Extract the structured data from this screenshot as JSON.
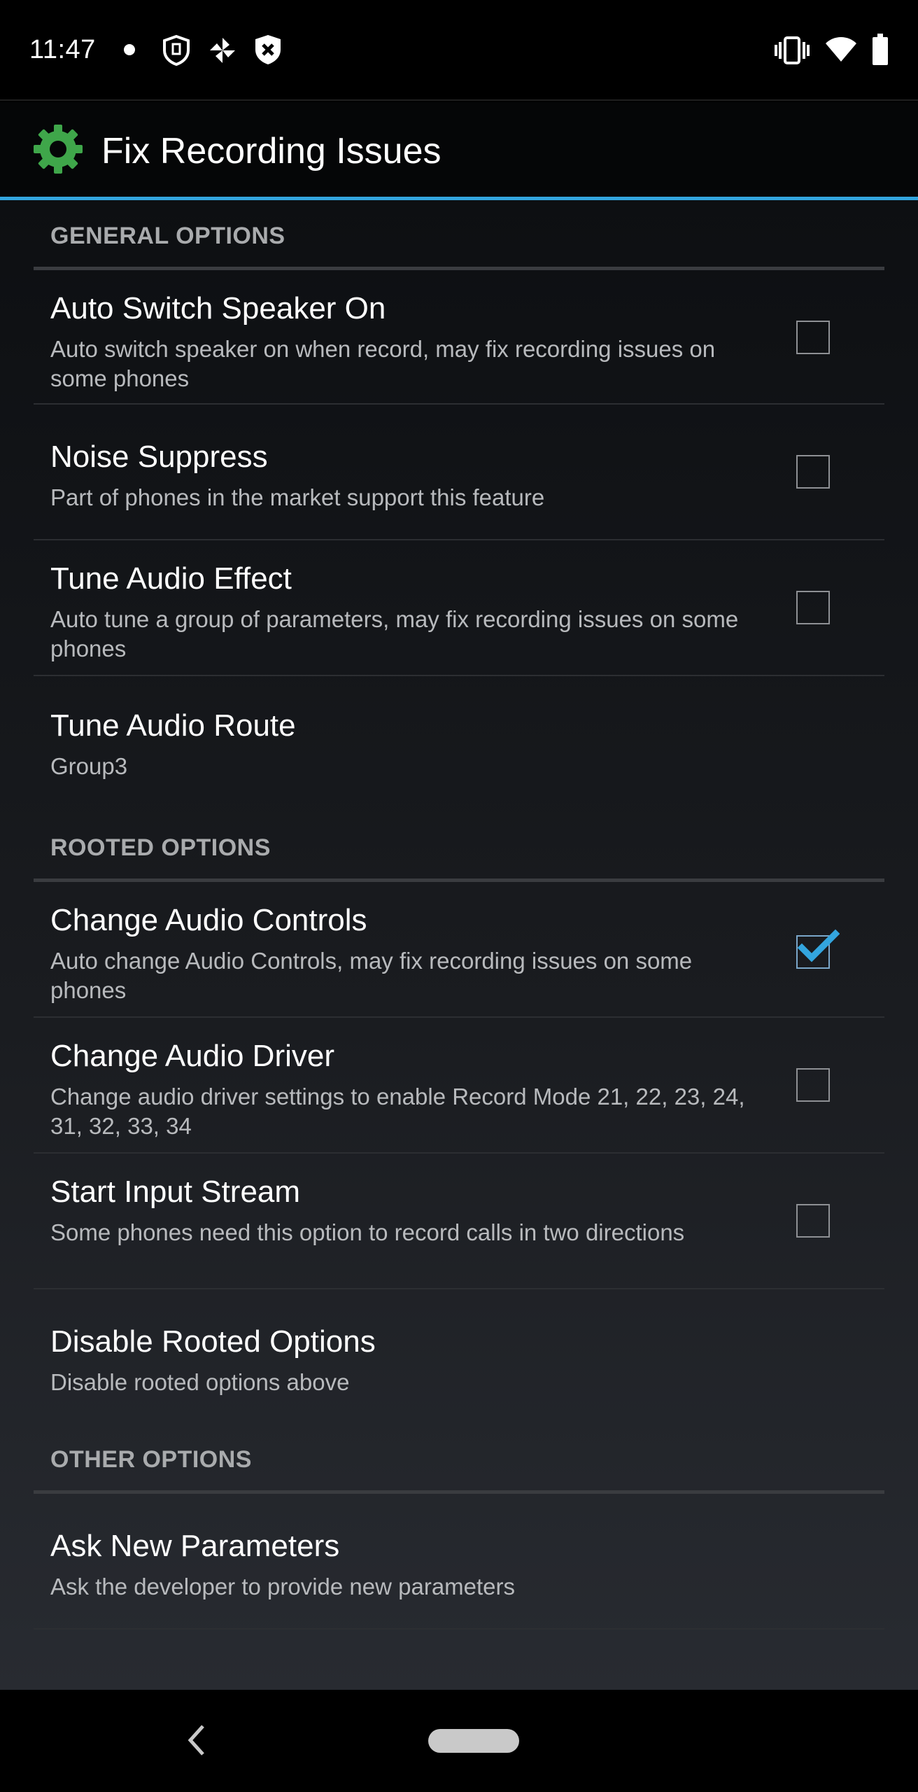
{
  "status_bar": {
    "time": "11:47",
    "left_icons": [
      "dot-icon",
      "shield-icon",
      "pinwheel-icon",
      "shield-x-icon"
    ],
    "right_icons": [
      "vibrate-icon",
      "wifi-icon",
      "battery-icon"
    ]
  },
  "action_bar": {
    "title": "Fix Recording Issues",
    "icon": "gear-icon",
    "icon_color": "#3fa64a"
  },
  "colors": {
    "accent": "#33a5de",
    "background": "#000000"
  },
  "sections": {
    "general": {
      "header": "GENERAL OPTIONS",
      "items": [
        {
          "title": "Auto Switch Speaker On",
          "summary": "Auto switch speaker on when record, may fix recording issues on some phones",
          "checked": false
        },
        {
          "title": "Noise Suppress",
          "summary": "Part of phones in the market support this feature",
          "checked": false
        },
        {
          "title": "Tune Audio Effect",
          "summary": "Auto tune a group of parameters, may fix recording issues on some phones",
          "checked": false
        },
        {
          "title": "Tune Audio Route",
          "summary": "Group3"
        }
      ]
    },
    "rooted": {
      "header": "ROOTED OPTIONS",
      "items": [
        {
          "title": "Change Audio Controls",
          "summary": "Auto change Audio Controls, may fix recording issues on some phones",
          "checked": true
        },
        {
          "title": "Change Audio Driver",
          "summary": "Change audio driver settings to enable Record Mode 21, 22, 23, 24, 31, 32, 33, 34",
          "checked": false
        },
        {
          "title": "Start Input Stream",
          "summary": "Some phones need this option to record calls in two directions",
          "checked": false
        },
        {
          "title": "Disable Rooted Options",
          "summary": "Disable rooted options above"
        }
      ]
    },
    "other": {
      "header": "OTHER OPTIONS",
      "items": [
        {
          "title": "Ask New Parameters",
          "summary": "Ask the developer to provide new parameters"
        }
      ]
    }
  },
  "nav_bar": {
    "icons": [
      "back-chevron-icon",
      "home-pill-icon"
    ]
  }
}
